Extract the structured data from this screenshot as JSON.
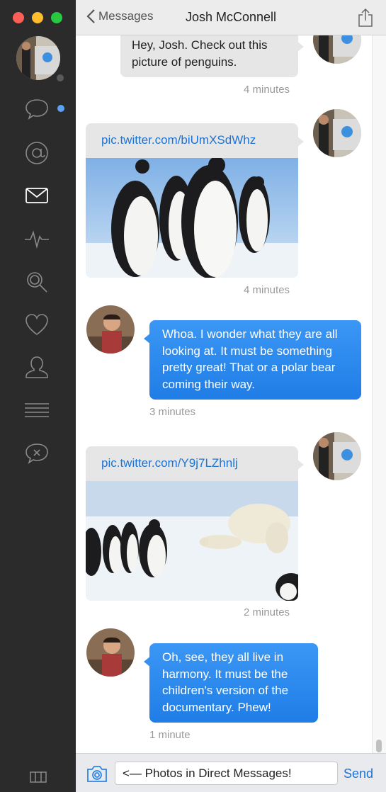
{
  "header": {
    "back_label": "Messages",
    "title": "Josh McConnell"
  },
  "sidebar": {
    "items": [
      {
        "icon": "chat-bubble-icon",
        "badge": true
      },
      {
        "icon": "at-sign-icon"
      },
      {
        "icon": "envelope-icon",
        "active": true
      },
      {
        "icon": "activity-icon"
      },
      {
        "icon": "search-icon"
      },
      {
        "icon": "heart-icon"
      },
      {
        "icon": "user-icon"
      },
      {
        "icon": "list-icon"
      },
      {
        "icon": "muted-chat-icon"
      }
    ]
  },
  "messages": [
    {
      "direction": "out",
      "text": "Hey, Josh. Check out this picture of penguins.",
      "time": "4 minutes"
    },
    {
      "direction": "out",
      "link": "pic.twitter.com/biUmXSdWhz",
      "image": "penguins-photo",
      "time": "4 minutes"
    },
    {
      "direction": "in",
      "text": "Whoa. I wonder what they are all looking at. It must be something pretty great! That or a polar bear coming their way.",
      "time": "3 minutes"
    },
    {
      "direction": "out",
      "link": "pic.twitter.com/Y9j7LZhnlj",
      "image": "polar-bear-penguins-photo",
      "time": "2 minutes"
    },
    {
      "direction": "in",
      "text": "Oh, see, they all live in harmony. It must be the children's version of the documentary. Phew!",
      "time": "1 minute"
    }
  ],
  "composer": {
    "value": "<— Photos in Direct Messages!",
    "send_label": "Send"
  },
  "colors": {
    "accent": "#1f73d1",
    "incoming_bubble": "#2d8cf0",
    "outgoing_bubble": "#e6e6e6",
    "sidebar": "#2b2b2b",
    "unread_dot": "#5aa2f5"
  }
}
